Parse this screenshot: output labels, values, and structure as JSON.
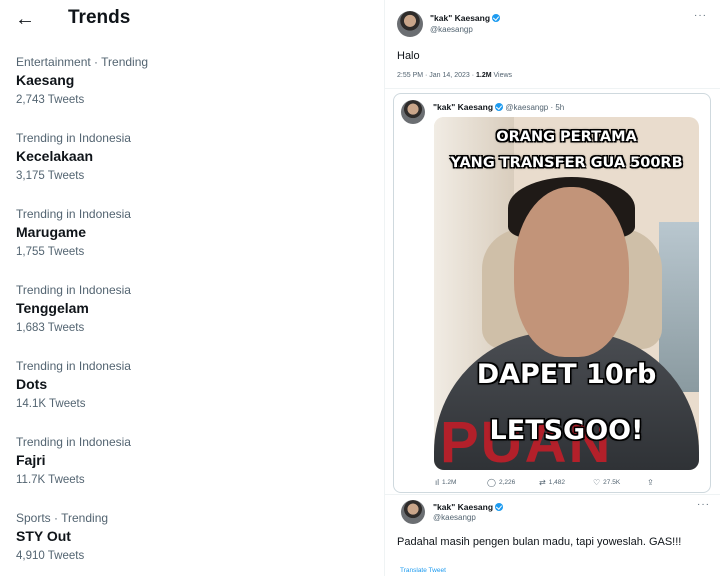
{
  "trends_panel": {
    "title": "Trends",
    "back_icon": "arrow-left-icon",
    "items": [
      {
        "category": "Entertainment · Trending",
        "name": "Kaesang",
        "count": "2,743 Tweets"
      },
      {
        "category": "Trending in Indonesia",
        "name": "Kecelakaan",
        "count": "3,175 Tweets"
      },
      {
        "category": "Trending in Indonesia",
        "name": "Marugame",
        "count": "1,755 Tweets"
      },
      {
        "category": "Trending in Indonesia",
        "name": "Tenggelam",
        "count": "1,683 Tweets"
      },
      {
        "category": "Trending in Indonesia",
        "name": "Dots",
        "count": "14.1K Tweets"
      },
      {
        "category": "Trending in Indonesia",
        "name": "Fajri",
        "count": "11.7K Tweets"
      },
      {
        "category": "Sports · Trending",
        "name": "STY Out",
        "count": "4,910 Tweets"
      }
    ]
  },
  "main_tweet": {
    "name": "\"kak\" Kaesang",
    "handle": "@kaesangp",
    "text": "Halo",
    "meta_time": "2:55 PM · Jan 14, 2023 · ",
    "meta_views": "1.2M",
    "meta_views_label": " Views",
    "more_icon": "more-icon"
  },
  "embedded_tweet": {
    "name": "\"kak\" Kaesang",
    "handle": "@kaesangp · 5h",
    "image_captions": {
      "line1": "ORANG PERTAMA",
      "line2": "YANG TRANSFER GUA 500RB",
      "line3": "DAPET 10rb",
      "line4": "LETSGOO!",
      "shirt_text": "PUAN"
    },
    "actions": {
      "views": "1.2M",
      "replies": "2,226",
      "retweets": "1,482",
      "likes": "27.5K"
    }
  },
  "reply_tweet": {
    "name": "\"kak\" Kaesang",
    "handle": "@kaesangp",
    "text": "Padahal masih pengen bulan madu, tapi yoweslah. GAS!!!",
    "translate_label": "Translate Tweet"
  },
  "colors": {
    "accent": "#1d9bf0",
    "secondary_text": "#536471",
    "primary_text": "#0f1419",
    "divider": "#eff3f4"
  }
}
